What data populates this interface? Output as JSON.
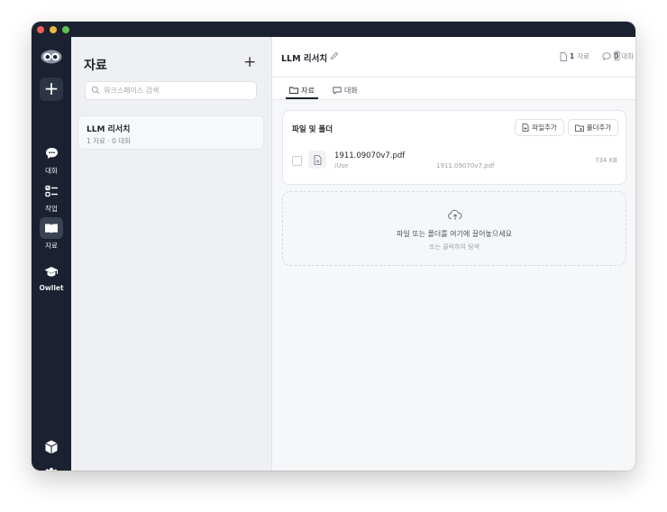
{
  "rail": {
    "new_label": "+",
    "items": [
      {
        "label": "대화",
        "icon": "chat-bubble-icon"
      },
      {
        "label": "작업",
        "icon": "task-list-icon"
      },
      {
        "label": "자료",
        "icon": "book-icon"
      },
      {
        "label": "Owllet",
        "icon": "graduation-cap-icon"
      }
    ]
  },
  "left_panel": {
    "title": "자료",
    "add_label": "+",
    "search_placeholder": "워크스페이스 검색",
    "workspaces": [
      {
        "name": "LLM 리서치",
        "meta": "1 자료 · 0 대화"
      }
    ]
  },
  "main": {
    "title": "LLM 리서치",
    "stats": {
      "docs_count": "1",
      "docs_label": "자료",
      "chats_count": "0",
      "chats_label": "대화"
    },
    "tabs": [
      {
        "label": "자료",
        "active": true
      },
      {
        "label": "대화",
        "active": false
      }
    ],
    "files_card": {
      "title": "파일 및 폴더",
      "add_file": "파일추가",
      "add_folder": "폴더추가",
      "files": [
        {
          "name": "1911.09070v7.pdf",
          "path": "/Use",
          "path_tail": "1911.09070v7.pdf",
          "size": "734 KB"
        }
      ]
    },
    "dropzone": {
      "text": "파일 또는 폴더를 여기에 끌어놓으세요",
      "subtext": "또는 클릭하여 탐색"
    }
  },
  "colors": {
    "rail_bg": "#1b2130",
    "panel_bg": "#eff0f3",
    "main_bg": "#f6f7f9"
  }
}
